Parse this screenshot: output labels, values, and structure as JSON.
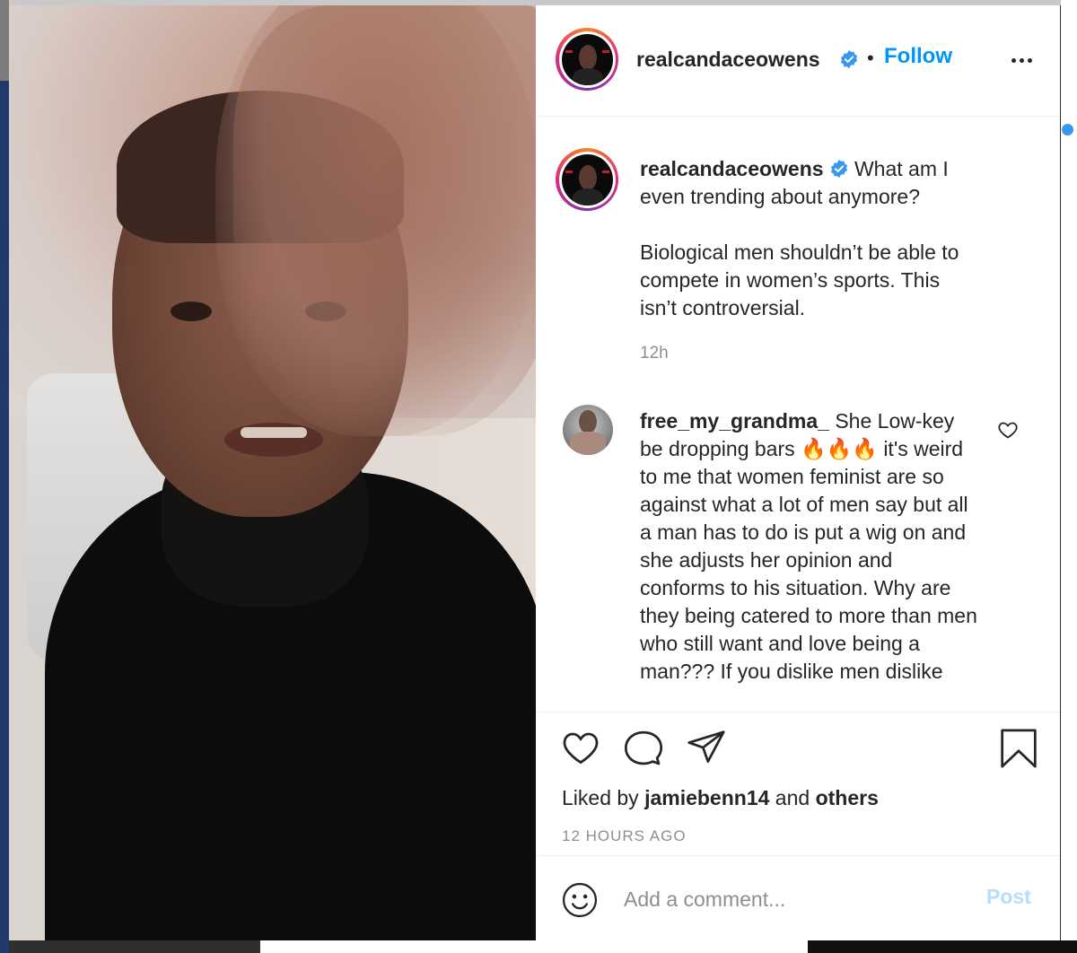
{
  "post": {
    "author": "realcandaceowens",
    "follow_label": "Follow",
    "separator": "•"
  },
  "caption": {
    "username": "realcandaceowens",
    "line1": "What am I even trending about anymore?",
    "line2": "Biological men shouldn’t be able to compete in women’s sports. This isn’t controversial.",
    "time": "12h"
  },
  "comment": {
    "username": "free_my_grandma_",
    "text": "She Low-key be dropping bars 🔥🔥🔥 it's weird to me that women feminist are so against what a lot of men say but all a man has to do is put a wig on and she adjusts her opinion and conforms to his situation. Why are they being catered to more than men who still want and love being a man??? If you dislike men dislike"
  },
  "likes": {
    "prefix": "Liked by",
    "user": "jamiebenn14",
    "conjunction": "and",
    "others": "others"
  },
  "timestamp": "12 HOURS AGO",
  "add_comment": {
    "placeholder": "Add a comment...",
    "post_label": "Post"
  },
  "icons": {
    "verified": "verified-badge-icon",
    "more": "more-options-icon",
    "like": "heart-icon",
    "comment": "comment-bubble-icon",
    "share": "paper-plane-icon",
    "save": "bookmark-icon",
    "emoji": "emoji-smile-icon"
  },
  "colors": {
    "accent": "#0095f6",
    "verified": "#3897f0",
    "post_disabled": "#b2dffc",
    "muted": "#8e8e8e"
  }
}
